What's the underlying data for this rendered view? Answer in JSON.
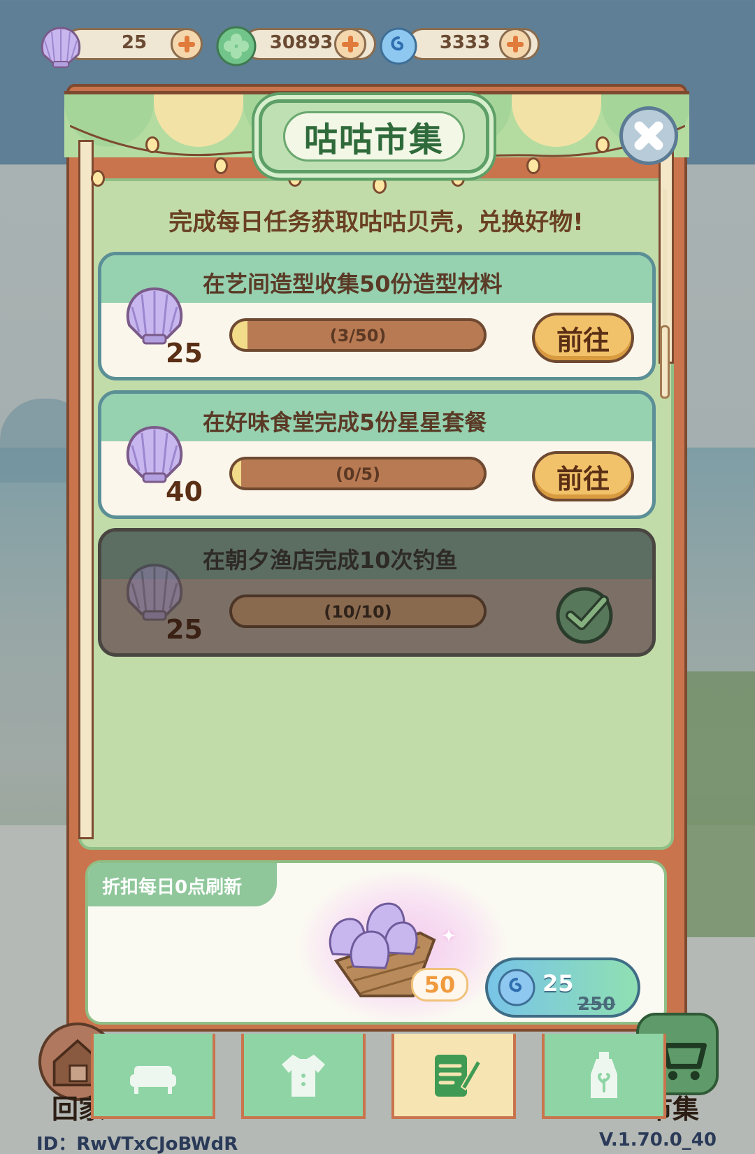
{
  "currencies": [
    {
      "icon": "shell-icon",
      "value": "25"
    },
    {
      "icon": "clover-coin-icon",
      "value": "30893"
    },
    {
      "icon": "swirl-gem-icon",
      "value": "3333"
    }
  ],
  "panel": {
    "title": "咕咕市集",
    "subtitle": "完成每日任务获取咕咕贝壳，兑换好物!"
  },
  "tasks": [
    {
      "title": "在艺间造型收集50份造型材料",
      "reward": "25",
      "progress_text": "(3/50)",
      "progress": 0.06,
      "action": "前往",
      "done": false
    },
    {
      "title": "在好味食堂完成5份星星套餐",
      "reward": "40",
      "progress_text": "(0/5)",
      "progress": 0.0,
      "action": "前往",
      "done": false
    },
    {
      "title": "在朝夕渔店完成10次钓鱼",
      "reward": "25",
      "progress_text": "(10/10)",
      "progress": 1.0,
      "action": "",
      "done": true
    }
  ],
  "discount": {
    "tag": "折扣每日0点刷新",
    "quantity": "50",
    "price": "25",
    "original_price": "250"
  },
  "nav": {
    "home_label": "回家",
    "market_label": "市集",
    "tabs": [
      "furniture-sofa-icon",
      "clothing-shirt-icon",
      "task-notepad-icon",
      "bottle-sprout-icon"
    ],
    "active_tab": 2
  },
  "footer": {
    "id": "ID：RwVTxCJoBWdR",
    "version": "V.1.70.0_40"
  }
}
